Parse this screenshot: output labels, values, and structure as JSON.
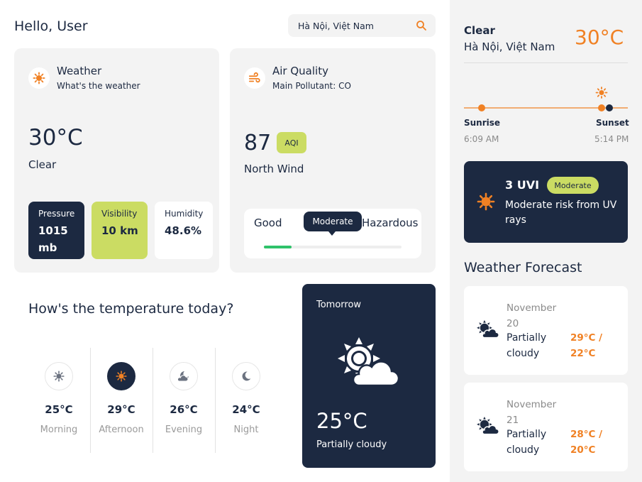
{
  "header": {
    "greeting": "Hello, User",
    "search_value": "Hà Nội, Việt Nam"
  },
  "weather_card": {
    "title": "Weather",
    "subtitle": "What's the weather",
    "temperature": "30°C",
    "condition": "Clear",
    "stats": [
      {
        "label": "Pressure",
        "value": "1015 mb"
      },
      {
        "label": "Visibility",
        "value": "10 km"
      },
      {
        "label": "Humidity",
        "value": "48.6%"
      }
    ]
  },
  "air_card": {
    "title": "Air Quality",
    "subtitle": "Main Pollutant: CO",
    "aqi_value": "87",
    "aqi_badge": "AQI",
    "wind": "North Wind",
    "scale": {
      "low_label": "Good",
      "current_label": "Moderate",
      "high_label": "Hazardous",
      "fill_fraction": 0.2
    }
  },
  "temperature_today": {
    "heading": "How's the temperature today?",
    "periods": [
      {
        "temp": "25°C",
        "name": "Morning",
        "icon": "sun-icon"
      },
      {
        "temp": "29°C",
        "name": "Afternoon",
        "icon": "sun-icon"
      },
      {
        "temp": "26°C",
        "name": "Evening",
        "icon": "moon-cloud-icon"
      },
      {
        "temp": "24°C",
        "name": "Night",
        "icon": "moon-icon"
      }
    ],
    "active_period": 1
  },
  "tomorrow": {
    "label": "Tomorrow",
    "temperature": "25°C",
    "condition": "Partially cloudy",
    "icon": "partly-cloudy-icon"
  },
  "current": {
    "condition": "Clear",
    "location": "Hà Nội, Việt Nam",
    "temperature": "30°C",
    "sunrise_label": "Sunrise",
    "sunrise_time": "6:09 AM",
    "sunset_label": "Sunset",
    "sunset_time": "5:14 PM"
  },
  "uv": {
    "value": "3 UVI",
    "badge": "Moderate",
    "description": "Moderate risk from UV rays"
  },
  "forecast": {
    "heading": "Weather Forecast",
    "items": [
      {
        "date": "November 20",
        "condition": "Partially cloudy",
        "temps": "29°C / 22°C"
      },
      {
        "date": "November 21",
        "condition": "Partially cloudy",
        "temps": "28°C / 20°C"
      }
    ]
  },
  "colors": {
    "navy": "#1c2941",
    "accent_orange": "#f08124",
    "lime": "#cbdc63",
    "good_green": "#2fc26a"
  }
}
